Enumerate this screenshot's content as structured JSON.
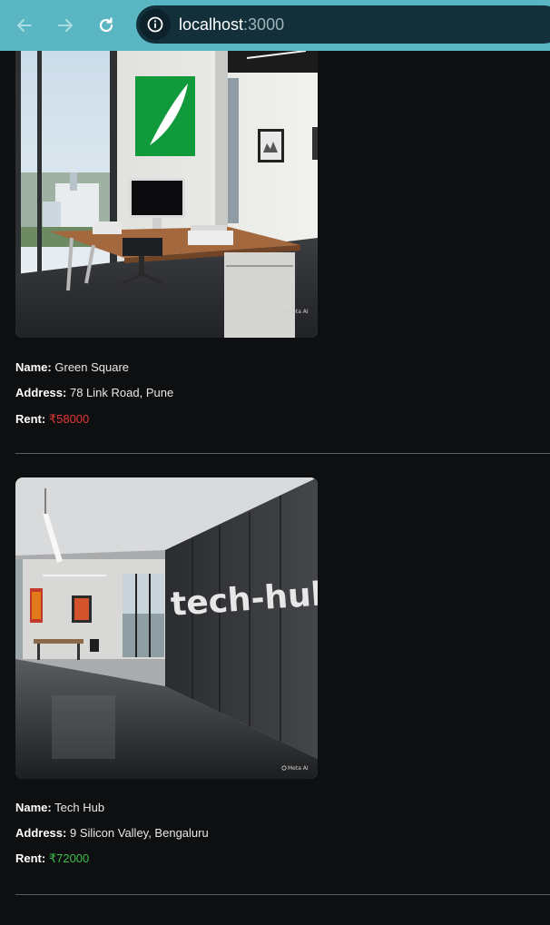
{
  "browser": {
    "url_host": "localhost",
    "url_port": ":3000",
    "icons": [
      "back-arrow-icon",
      "forward-arrow-icon",
      "reload-icon",
      "info-icon"
    ]
  },
  "labels": {
    "name": "Name:",
    "address": "Address:",
    "rent": "Rent:"
  },
  "properties": [
    {
      "name": "Green Square",
      "address": "78 Link Road, Pune",
      "rent": "₹58000",
      "rent_status_color": "#e53935",
      "watermark": "Meta AI"
    },
    {
      "name": "Tech Hub",
      "address": "9 Silicon Valley, Bengaluru",
      "rent": "₹72000",
      "rent_status_color": "#3fbf4a",
      "watermark": "Meta AI",
      "wall_sign": "tech-hub"
    }
  ]
}
